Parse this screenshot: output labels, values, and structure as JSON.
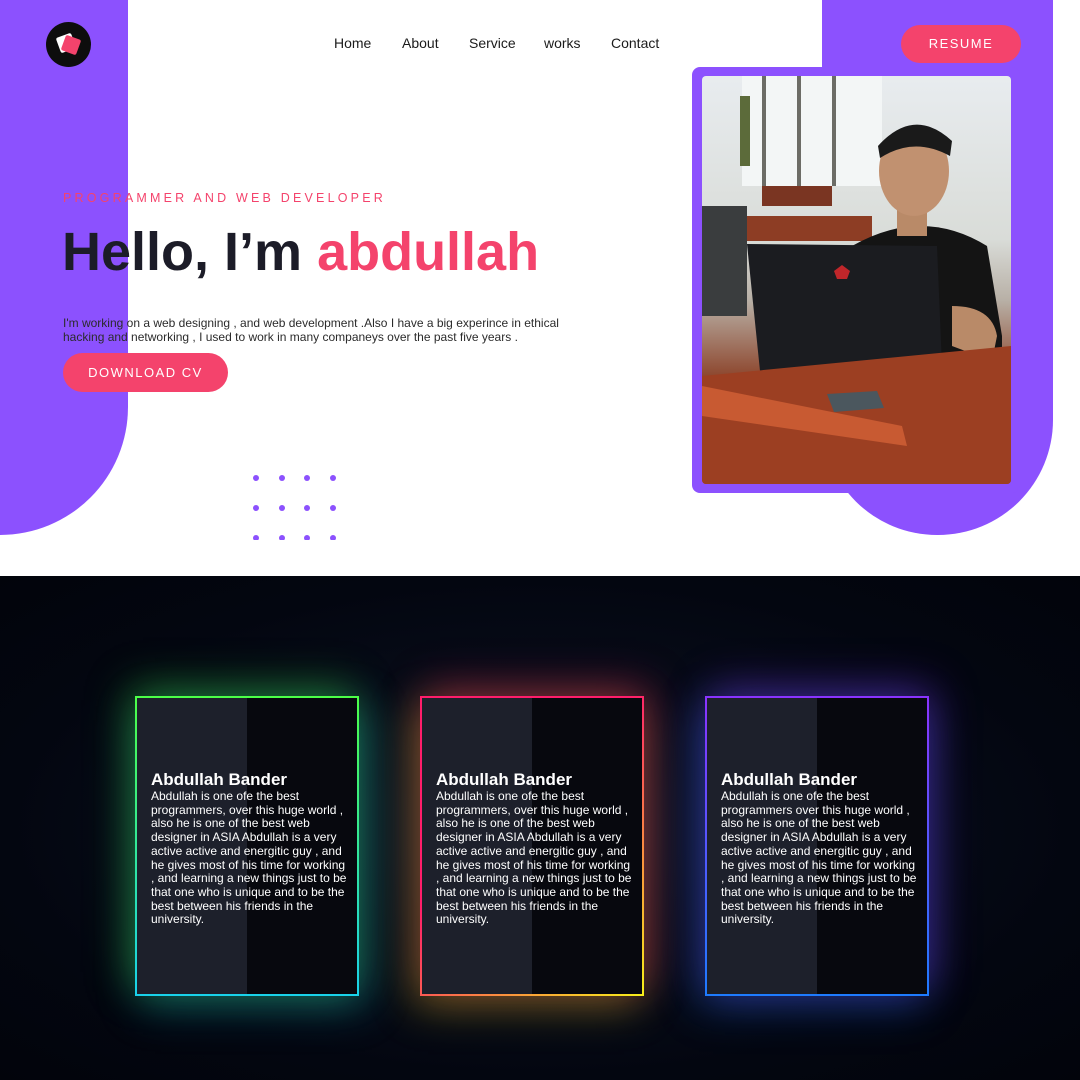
{
  "nav": {
    "items": [
      "Home",
      "About",
      "Service",
      "works",
      "Contact"
    ],
    "resume_label": "RESUME"
  },
  "hero": {
    "tagline": "PROGRAMMER AND WEB DEVELOPER",
    "greeting": "Hello, I’m ",
    "name": "abdullah",
    "intro": "I'm working on a web designing , and web development .Also I have a big experince in ethical hacking and networking , I used to work in many companeys over the past five years .",
    "download_label": "DOWNLOAD CV"
  },
  "cards": [
    {
      "title": "Abdullah Bander",
      "body": "Abdullah is one ofe the best programmers, over this huge world , also he is one of the best web designer in ASIA Abdullah is a very active active and energitic guy , and he gives most of his time for working , and learning a new things just to be that one who is unique and to be the best between his friends in the university."
    },
    {
      "title": "Abdullah Bander",
      "body": "Abdullah is one ofe the best programmers, over this huge world , also he is one of the best web designer in ASIA Abdullah is a very active active and energitic guy , and he gives most of his time for working , and learning a new things just to be that one who is unique and to be the best between his friends in the university."
    },
    {
      "title": "Abdullah Bander",
      "body": "Abdullah is one ofe the best programmers over this huge world , also he is one of the best web designer in ASIA Abdullah is a very active active and energitic guy , and he gives most of his time for working , and learning a new things just to be that one who is unique and to be the best between his friends in the university."
    }
  ],
  "colors": {
    "accent_pink": "#f4436c",
    "brand_purple": "#8c51fe",
    "dark_bg": "#02040b"
  }
}
